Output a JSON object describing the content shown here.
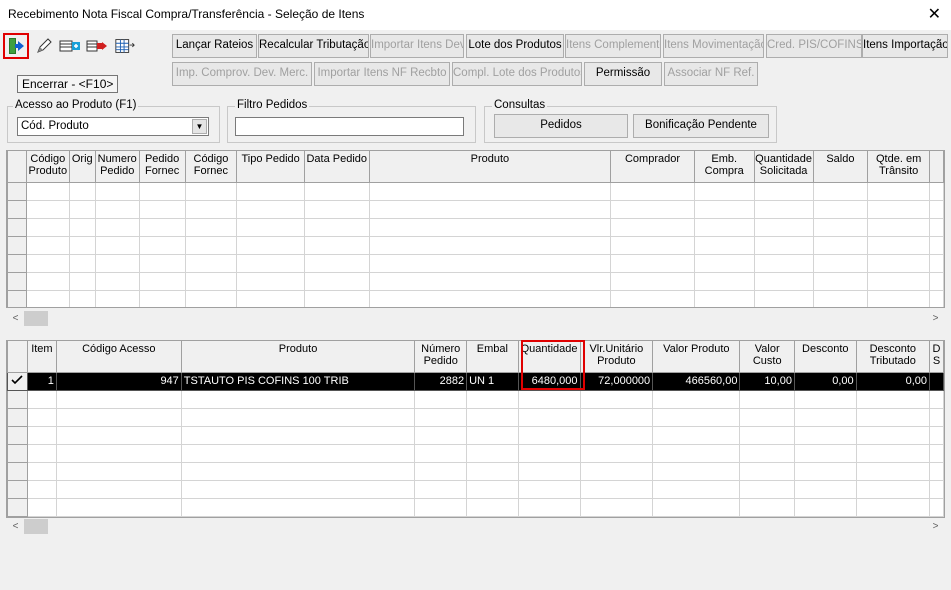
{
  "window": {
    "title": "Recebimento Nota Fiscal Compra/Transferência - Seleção de Itens",
    "close_glyph": "✕"
  },
  "toolbar": {
    "icons": [
      "exit-door-icon",
      "pencil-icon",
      "add-record-icon",
      "remove-record-icon",
      "grid-list-icon"
    ],
    "tooltip": "Encerrar - <F10>",
    "row1": [
      {
        "label": "Lançar Rateios",
        "enabled": true
      },
      {
        "label": "Recalcular Tributação",
        "enabled": true
      },
      {
        "label": "Importar Itens Dev.",
        "enabled": false
      },
      {
        "label": "Lote dos Produtos",
        "enabled": true
      },
      {
        "label": "Itens Complemento",
        "enabled": false
      },
      {
        "label": "Itens Movimentação",
        "enabled": false
      },
      {
        "label": "Cred. PIS/COFINS",
        "enabled": false
      },
      {
        "label": "Itens Importação",
        "enabled": true
      }
    ],
    "row2": [
      {
        "label": "Imp. Comprov. Dev. Merc.",
        "enabled": false
      },
      {
        "label": "Importar Itens NF Recbto",
        "enabled": false
      },
      {
        "label": "Compl. Lote dos Produtos",
        "enabled": false
      },
      {
        "label": "Permissão",
        "enabled": true
      },
      {
        "label": "Associar NF Ref.",
        "enabled": false
      }
    ]
  },
  "filters": {
    "acesso_label": "Acesso ao Produto (F1)",
    "acesso_value": "Cód. Produto",
    "filtro_label": "Filtro Pedidos",
    "filtro_value": "",
    "consultas_label": "Consultas",
    "pedidos_button": "Pedidos",
    "bonificacao_button": "Bonificação Pendente"
  },
  "upper_grid": {
    "columns": [
      "Código Produto",
      "Orig",
      "Numero Pedido",
      "Pedido Fornec",
      "Código Fornec",
      "Tipo Pedido",
      "Data Pedido",
      "Produto",
      "Comprador",
      "Emb. Compra",
      "Quantidade Solicitada",
      "Saldo",
      "Qtde. em Trânsito"
    ]
  },
  "lower_grid": {
    "columns": [
      "Item",
      "Código Acesso",
      "Produto",
      "Número Pedido",
      "Embal",
      "Quantidade",
      "Vlr.Unitário Produto",
      "Valor Produto",
      "Valor Custo",
      "Desconto",
      "Desconto Tributado",
      "D S"
    ],
    "rows": [
      {
        "item": "1",
        "codigo_acesso": "947",
        "produto": "TSTAUTO PIS COFINS 100 TRIB",
        "numero_pedido": "2882",
        "embal": "UN  1",
        "quantidade": "6480,000",
        "vlr_unitario": "72,000000",
        "valor_produto": "466560,00",
        "valor_custo": "10,00",
        "desconto": "0,00",
        "desconto_tributado": "0,00"
      }
    ]
  },
  "colors": {
    "highlight": "#e00000",
    "selected_row": "#000000"
  }
}
